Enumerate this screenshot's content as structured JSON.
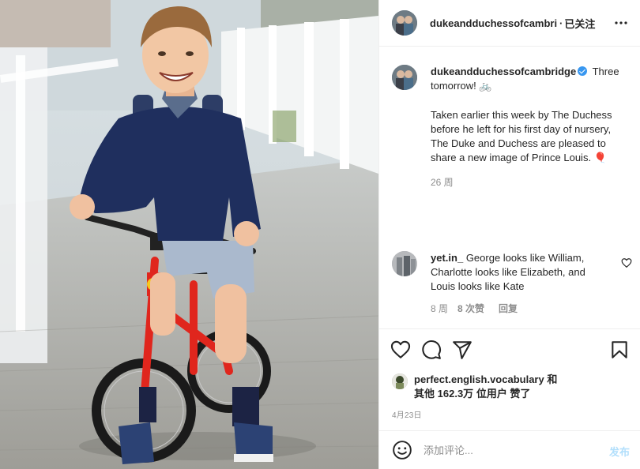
{
  "header": {
    "username": "dukeandduchessofcambri",
    "separator": "·",
    "follow_label": "已关注",
    "more_icon": "more-horizontal-icon"
  },
  "caption": {
    "username": "dukeandduchessofcambridge",
    "verified": true,
    "line1": "Three tomorrow!",
    "emoji": "🚲",
    "paragraph": "Taken earlier this week by The Duchess before he left for his first day of nursery, The Duke and Duchess are pleased to share a new image of Prince Louis.",
    "paragraph_emoji": "🎈",
    "time": "26 周"
  },
  "comment": {
    "username": "yet.in_",
    "text": "George looks like William, Charlotte looks like Elizabeth, and Louis looks like Kate",
    "age": "8 周",
    "likes": "8 次赞",
    "reply": "回复"
  },
  "actions": {
    "like_icon": "heart-icon",
    "comment_icon": "comment-icon",
    "share_icon": "share-icon",
    "save_icon": "bookmark-icon"
  },
  "likes": {
    "user": "perfect.english.vocabulary",
    "and": "和",
    "others": "其他",
    "count": "162.3万",
    "suffix": "位用户 赞了"
  },
  "date": "4月23日",
  "add_comment": {
    "placeholder": "添加评论...",
    "publish_label": "发布",
    "emoji_icon": "smile-icon"
  },
  "colors": {
    "verified": "#3897f0",
    "publish_disabled": "#b2dffc",
    "secondary_text": "#8e8e8e"
  }
}
